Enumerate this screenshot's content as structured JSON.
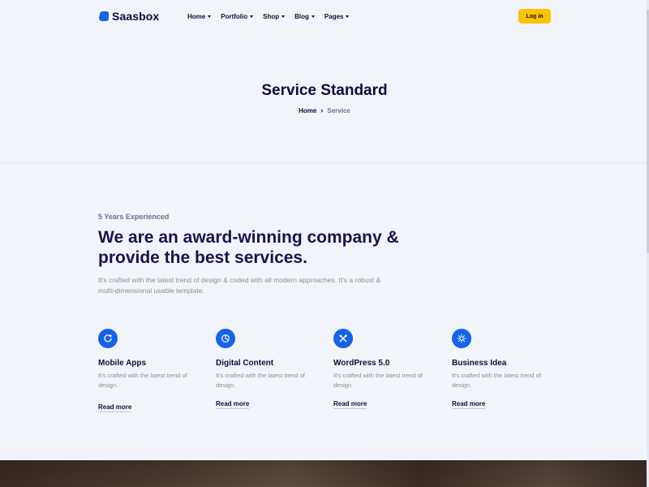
{
  "header": {
    "logo_text": "Saasbox",
    "nav": [
      {
        "label": "Home"
      },
      {
        "label": "Portfolio"
      },
      {
        "label": "Shop"
      },
      {
        "label": "Blog"
      },
      {
        "label": "Pages"
      }
    ],
    "login_label": "Log in"
  },
  "hero": {
    "title": "Service Standard",
    "breadcrumb": {
      "home": "Home",
      "separator": "›",
      "current": "Service"
    }
  },
  "intro": {
    "eyebrow": "5 Years Experienced",
    "title": "We are an award-winning company & provide the best services.",
    "description": "It's crafted with the latest trend of design & coded with all modern approaches. It's a robust & multi-dimensional usable template."
  },
  "services": [
    {
      "icon": "mobile-app-icon",
      "title": "Mobile Apps",
      "description": "It's crafted with the latest trend of design.",
      "link": "Read more"
    },
    {
      "icon": "pie-chart-icon",
      "title": "Digital Content",
      "description": "It's crafted with the latest trend of design.",
      "link": "Read more"
    },
    {
      "icon": "tools-icon",
      "title": "WordPress 5.0",
      "description": "It's crafted with the latest trend of design.",
      "link": "Read more"
    },
    {
      "icon": "lightbulb-icon",
      "title": "Business Idea",
      "description": "It's crafted with the latest trend of design.",
      "link": "Read more"
    }
  ],
  "colors": {
    "accent": "#1563e6",
    "button": "#fbc400",
    "heading": "#0f0c3d",
    "background": "#f2f4fc"
  }
}
